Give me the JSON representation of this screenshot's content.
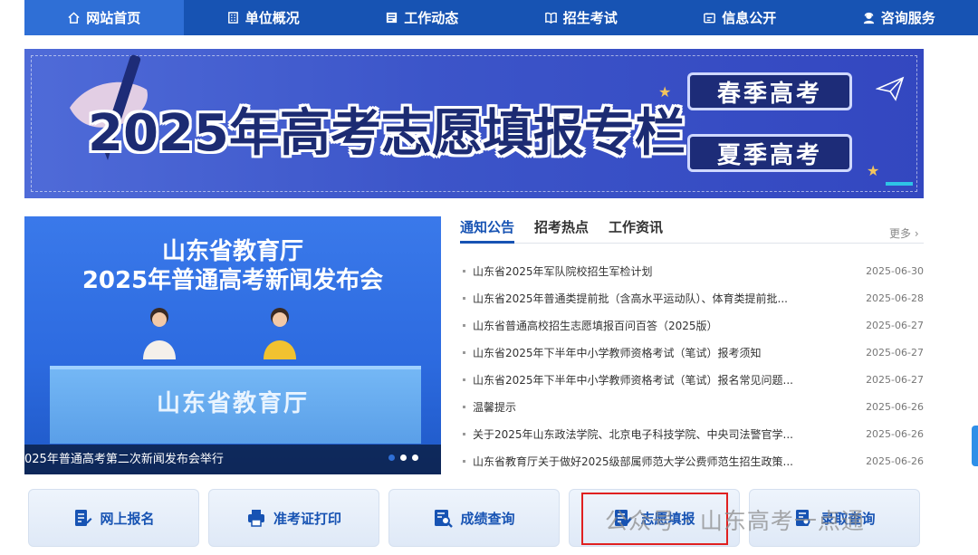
{
  "nav": {
    "items": [
      {
        "label": "网站首页",
        "icon": "home-icon",
        "active": true
      },
      {
        "label": "单位概况",
        "icon": "building-icon"
      },
      {
        "label": "工作动态",
        "icon": "document-icon"
      },
      {
        "label": "招生考试",
        "icon": "book-icon"
      },
      {
        "label": "信息公开",
        "icon": "id-card-icon"
      },
      {
        "label": "咨询服务",
        "icon": "user-service-icon"
      }
    ]
  },
  "banner": {
    "title": "2025年高考志愿填报专栏",
    "spring_label": "春季高考",
    "summer_label": "夏季高考"
  },
  "slide": {
    "heading_line1": "山东省教育厅",
    "heading_line2": "2025年普通高考新闻发布会",
    "desk_text": "山东省教育厅",
    "caption": "025年普通高考第二次新闻发布会举行"
  },
  "news": {
    "tabs": [
      "通知公告",
      "招考热点",
      "工作资讯"
    ],
    "more": "更多",
    "items": [
      {
        "title": "山东省2025年军队院校招生军检计划",
        "date": "2025-06-30"
      },
      {
        "title": "山东省2025年普通类提前批（含高水平运动队）、体育类提前批...",
        "date": "2025-06-28"
      },
      {
        "title": "山东省普通高校招生志愿填报百问百答（2025版）",
        "date": "2025-06-27"
      },
      {
        "title": "山东省2025年下半年中小学教师资格考试（笔试）报考须知",
        "date": "2025-06-27"
      },
      {
        "title": "山东省2025年下半年中小学教师资格考试（笔试）报名常见问题...",
        "date": "2025-06-27"
      },
      {
        "title": "温馨提示",
        "date": "2025-06-26"
      },
      {
        "title": "关于2025年山东政法学院、北京电子科技学院、中央司法警官学...",
        "date": "2025-06-26"
      },
      {
        "title": "山东省教育厅关于做好2025级部属师范大学公费师范生招生政策...",
        "date": "2025-06-26"
      }
    ]
  },
  "services": [
    {
      "label": "网上报名",
      "icon": "register-icon"
    },
    {
      "label": "准考证打印",
      "icon": "printer-icon"
    },
    {
      "label": "成绩查询",
      "icon": "score-search-icon"
    },
    {
      "label": "志愿填报",
      "icon": "application-form-icon"
    },
    {
      "label": "录取查询",
      "icon": "admission-search-icon"
    }
  ],
  "watermark": "公众号 · 山东高考一点通",
  "colors": {
    "nav": "#1753b3",
    "accent": "#2f6fd6",
    "highlight": "#e02020"
  }
}
